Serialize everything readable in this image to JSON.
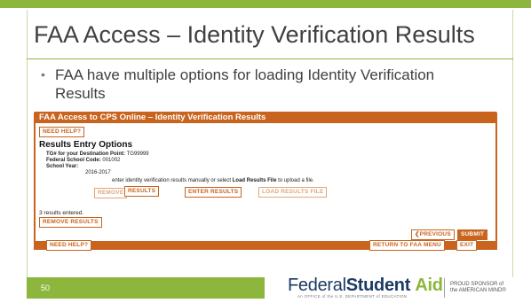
{
  "slide": {
    "title": "FAA Access – Identity Verification Results",
    "bullet": "FAA have multiple options for loading Identity Verification Results",
    "page_number": "50"
  },
  "screenshot": {
    "window_title": "FAA Access to CPS Online – Identity Verification Results",
    "need_help_top": "NEED HELP?",
    "heading": "Results Entry Options",
    "tg_label": "TG# for your Destination Point:",
    "tg_value": "TG99999",
    "school_code_label": "Federal School Code:",
    "school_code_value": "001002",
    "school_year_label": "School Year:",
    "school_year_value": "2016-2017",
    "instruction_pre": "enter identity verification results manually or select",
    "instruction_bold": "Load Results File",
    "instruction_post": "to upload a file.",
    "btn_remove_overlap": "REMOVE",
    "btn_results": "RESULTS",
    "btn_enter_results": "ENTER RESULTS",
    "btn_load_results_file": "LOAD RESULTS FILE",
    "results_count": "3 results entered.",
    "btn_remove_results": "REMOVE RESULTS",
    "btn_previous": "PREVIOUS",
    "btn_submit": "SUBMIT",
    "need_help_bottom": "NEED HELP?",
    "btn_return": "RETURN TO FAA MENU",
    "btn_exit": "EXIT"
  },
  "footer": {
    "brand_part1": "Federal",
    "brand_part2": "Student",
    "brand_part3": "Aid",
    "brand_sub": "An OFFICE of the U.S. DEPARTMENT of EDUCATION",
    "sponsor_line1": "PROUD SPONSOR of",
    "sponsor_line2": "the AMERICAN MIND®"
  },
  "colors": {
    "accent_green": "#8cb63c",
    "orange": "#c8641e",
    "navy": "#1b3a64"
  }
}
